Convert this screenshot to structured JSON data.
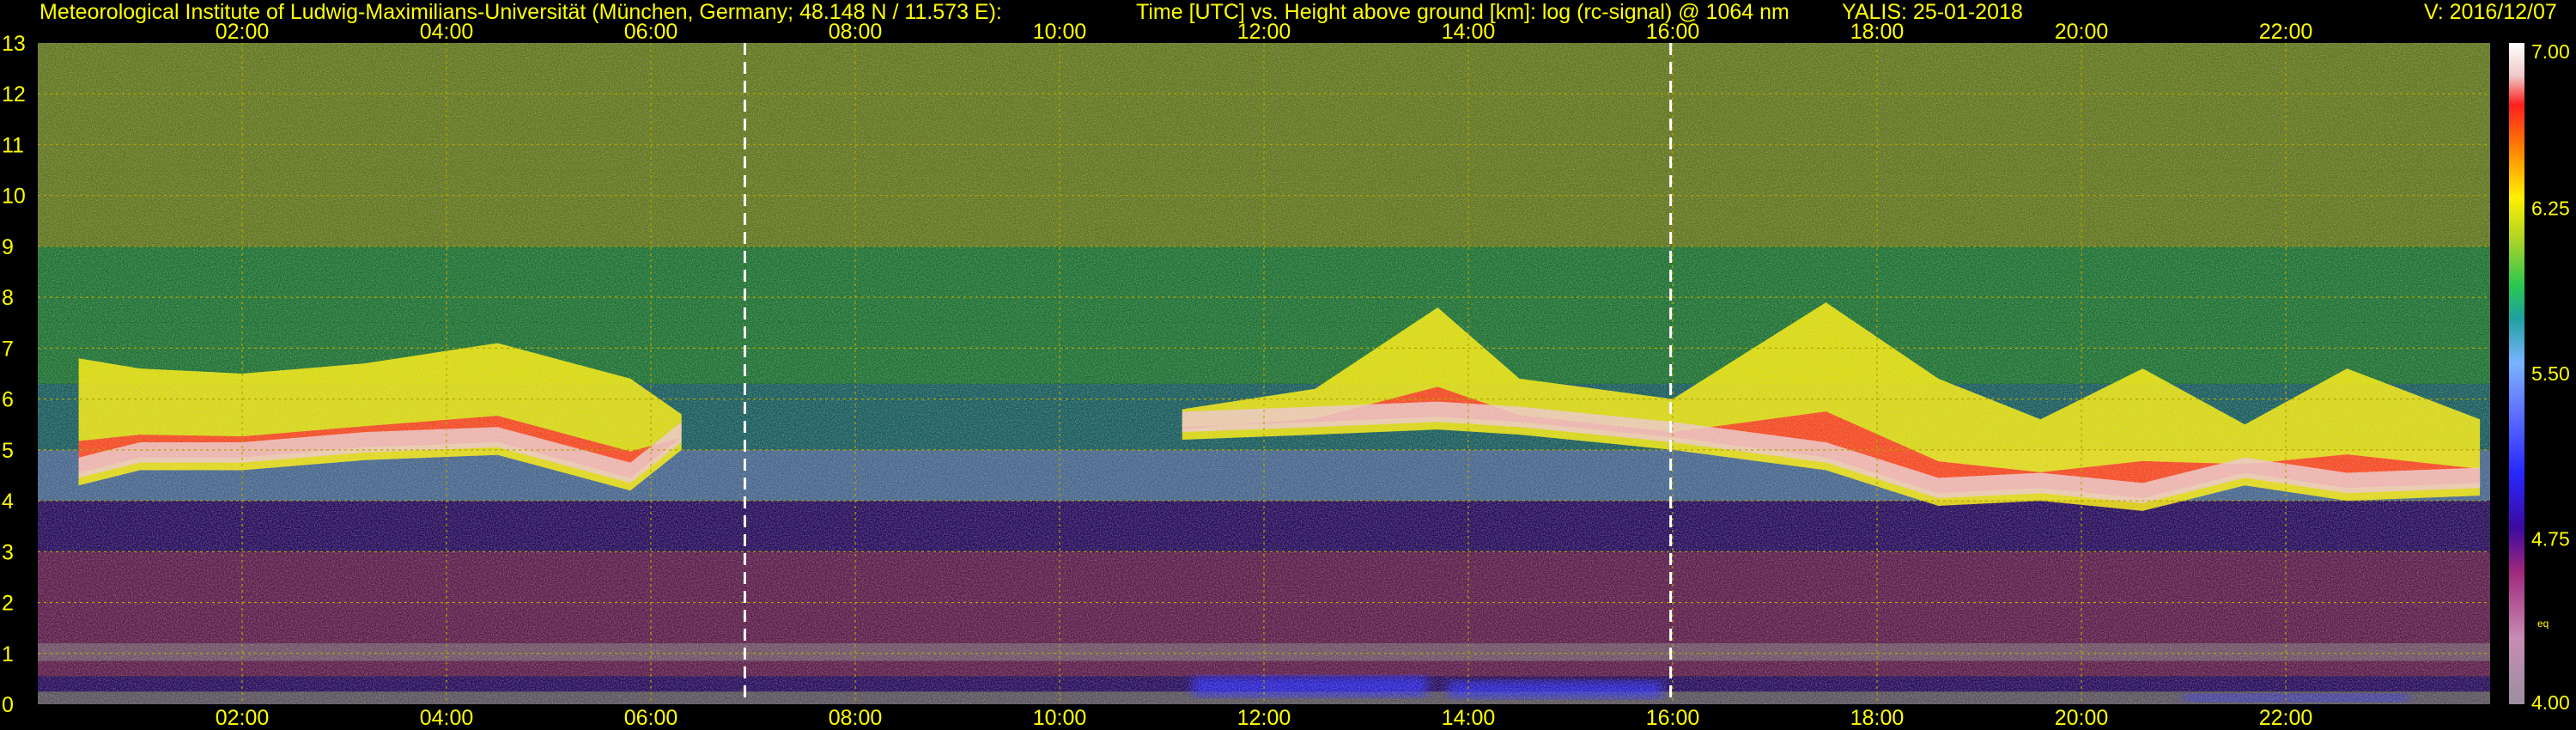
{
  "header": {
    "institute": "Meteorological Institute of Ludwig-Maximilians-Universität (München, Germany; 48.148 N / 11.573 E):",
    "axes_description": "Time [UTC] vs. Height above ground [km]: log (rc-signal) @ 1064 nm",
    "instrument_date": "YALIS: 25-01-2018",
    "version": "V: 2016/12/07"
  },
  "colors": {
    "text": "#ffff00",
    "grid": "#b5a400",
    "background": "#000000",
    "marker_line": "#ffffff"
  },
  "chart_data": {
    "type": "heatmap",
    "title": "Time [UTC] vs. Height above ground [km]: log (rc-signal) @ 1064 nm",
    "xlabel": "Time [UTC]",
    "ylabel": "Height above ground [km]",
    "x_ticks": [
      "02:00",
      "04:00",
      "06:00",
      "08:00",
      "10:00",
      "12:00",
      "14:00",
      "16:00",
      "18:00",
      "20:00",
      "22:00"
    ],
    "x_tick_hours": [
      2,
      4,
      6,
      8,
      10,
      12,
      14,
      16,
      18,
      20,
      22
    ],
    "xlim_hours": [
      0,
      24
    ],
    "y_ticks": [
      "0",
      "1",
      "2",
      "3",
      "4",
      "5",
      "6",
      "7",
      "8",
      "9",
      "10",
      "11",
      "12",
      "13"
    ],
    "ylim_km": [
      0,
      13
    ],
    "grid": true,
    "vertical_markers_hours": [
      6.92,
      15.98
    ],
    "colorbar": {
      "ticks": [
        "7.00",
        "6.25",
        "5.50",
        "4.75",
        "4.00"
      ],
      "tick_values": [
        7.0,
        6.25,
        5.5,
        4.75,
        4.0
      ],
      "range": [
        4.0,
        7.0
      ],
      "note": "eq",
      "stops": [
        {
          "v": 4.0,
          "c": "#9c8fa0"
        },
        {
          "v": 4.3,
          "c": "#c78cb4"
        },
        {
          "v": 4.6,
          "c": "#a0287d"
        },
        {
          "v": 4.8,
          "c": "#3c0aa0"
        },
        {
          "v": 5.05,
          "c": "#2828ff"
        },
        {
          "v": 5.35,
          "c": "#6478ff"
        },
        {
          "v": 5.55,
          "c": "#78b4ff"
        },
        {
          "v": 5.75,
          "c": "#1fa0a0"
        },
        {
          "v": 5.9,
          "c": "#28c850"
        },
        {
          "v": 6.1,
          "c": "#aad228"
        },
        {
          "v": 6.3,
          "c": "#fff000"
        },
        {
          "v": 6.5,
          "c": "#ff8c00"
        },
        {
          "v": 6.72,
          "c": "#ff1e1e"
        },
        {
          "v": 6.85,
          "c": "#f0c8c8"
        },
        {
          "v": 7.0,
          "c": "#ffffff"
        }
      ]
    },
    "cloud_layer_top_km": [
      {
        "t": 0.4,
        "km": 6.8
      },
      {
        "t": 1.0,
        "km": 6.6
      },
      {
        "t": 2.0,
        "km": 6.5
      },
      {
        "t": 3.2,
        "km": 6.7
      },
      {
        "t": 4.5,
        "km": 7.1
      },
      {
        "t": 5.8,
        "km": 6.4
      },
      {
        "t": 6.3,
        "km": 5.7
      },
      {
        "t": 11.2,
        "km": 5.8
      },
      {
        "t": 12.5,
        "km": 6.2
      },
      {
        "t": 13.7,
        "km": 7.8
      },
      {
        "t": 14.5,
        "km": 6.4
      },
      {
        "t": 16.0,
        "km": 6.0
      },
      {
        "t": 17.5,
        "km": 7.9
      },
      {
        "t": 18.6,
        "km": 6.4
      },
      {
        "t": 19.6,
        "km": 5.6
      },
      {
        "t": 20.6,
        "km": 6.6
      },
      {
        "t": 21.6,
        "km": 5.5
      },
      {
        "t": 22.6,
        "km": 6.6
      },
      {
        "t": 23.9,
        "km": 5.6
      }
    ],
    "cloud_layer_base_km": [
      {
        "t": 0.4,
        "km": 4.3
      },
      {
        "t": 1.0,
        "km": 4.6
      },
      {
        "t": 2.0,
        "km": 4.6
      },
      {
        "t": 3.2,
        "km": 4.8
      },
      {
        "t": 4.5,
        "km": 4.9
      },
      {
        "t": 5.8,
        "km": 4.2
      },
      {
        "t": 6.3,
        "km": 5.0
      },
      {
        "t": 11.2,
        "km": 5.2
      },
      {
        "t": 12.5,
        "km": 5.3
      },
      {
        "t": 13.7,
        "km": 5.4
      },
      {
        "t": 14.5,
        "km": 5.3
      },
      {
        "t": 16.0,
        "km": 5.0
      },
      {
        "t": 17.5,
        "km": 4.6
      },
      {
        "t": 18.6,
        "km": 3.9
      },
      {
        "t": 19.6,
        "km": 4.0
      },
      {
        "t": 20.6,
        "km": 3.8
      },
      {
        "t": 21.6,
        "km": 4.3
      },
      {
        "t": 22.6,
        "km": 4.0
      },
      {
        "t": 23.9,
        "km": 4.1
      }
    ]
  }
}
